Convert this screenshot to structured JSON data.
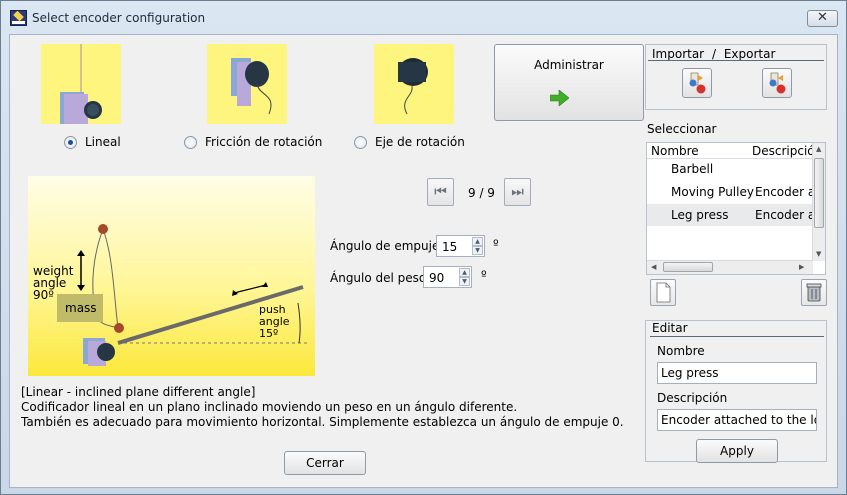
{
  "window": {
    "title": "Select encoder configuration",
    "close_glyph": "✕"
  },
  "mode": {
    "options": [
      {
        "label": "Lineal",
        "checked": true
      },
      {
        "label": "Fricción de rotación",
        "checked": false
      },
      {
        "label": "Eje de rotación",
        "checked": false
      }
    ]
  },
  "admin": {
    "label": "Administrar",
    "icon": "green-arrow-right-icon"
  },
  "navigator": {
    "counter": "9 / 9",
    "first_icon": "skip-first-icon",
    "last_icon": "skip-last-icon"
  },
  "diagram": {
    "weight_angle_label_1": "weight",
    "weight_angle_label_2": "angle",
    "weight_angle_label_3": "90º",
    "mass_label": "mass",
    "push_angle_label_1": "push",
    "push_angle_label_2": "angle",
    "push_angle_label_3": "15º"
  },
  "params": {
    "push_angle": {
      "label": "Ángulo de empuje",
      "value": "15",
      "unit": "º"
    },
    "weight_angle": {
      "label": "Ángulo del peso",
      "value": "90",
      "unit": "º"
    }
  },
  "description": {
    "line1": "[Linear - inclined plane different angle]",
    "line2": "Codificador lineal en un plano inclinado moviendo un peso en un ángulo diferente.",
    "line3": "También es adecuado para movimiento horizontal. Simplemente establezca un ángulo de empuje 0."
  },
  "close_button": {
    "label": "Cerrar"
  },
  "import_export": {
    "title_import": "Importar",
    "separator": "/",
    "title_export": "Exportar",
    "import_icon": "import-icon",
    "export_icon": "export-icon"
  },
  "select": {
    "title": "Seleccionar",
    "columns": [
      "Nombre",
      "Descripción"
    ],
    "rows": [
      {
        "name": "Barbell",
        "description": ""
      },
      {
        "name": "Moving Pulley",
        "description": "Encoder at"
      },
      {
        "name": "Leg press",
        "description": "Encoder at"
      }
    ],
    "selected_index": 2
  },
  "edit": {
    "title": "Editar",
    "name_label": "Nombre",
    "name_value": "Leg press",
    "description_label": "Descripción",
    "description_value": "Encoder attached to the load",
    "apply_label": "Apply",
    "new_icon": "new-document-icon",
    "delete_icon": "trash-icon"
  },
  "colors": {
    "thumbnail_bg": "#fdf57d",
    "selection_bg": "#e8eaec",
    "accent_arrow": "#3fae2a"
  }
}
